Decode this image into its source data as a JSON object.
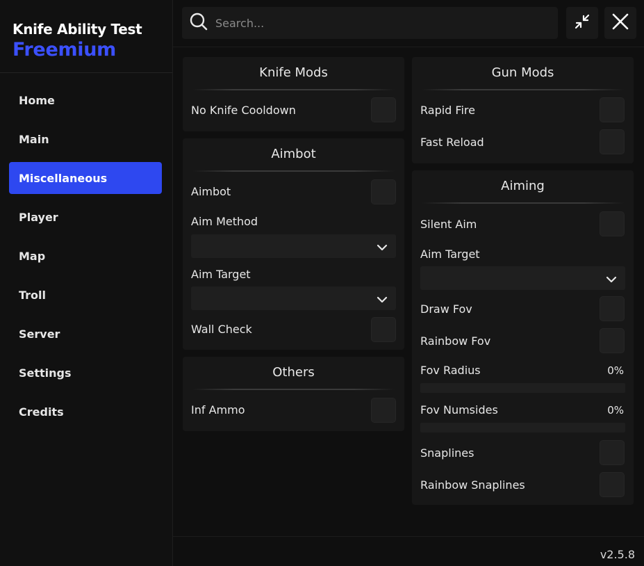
{
  "app": {
    "title": "Knife Ability Test",
    "subtitle": "Freemium",
    "version": "v2.5.8"
  },
  "search": {
    "placeholder": "Search..."
  },
  "sidebar": {
    "items": [
      {
        "label": "Home"
      },
      {
        "label": "Main"
      },
      {
        "label": "Miscellaneous",
        "active": true
      },
      {
        "label": "Player"
      },
      {
        "label": "Map"
      },
      {
        "label": "Troll"
      },
      {
        "label": "Server"
      },
      {
        "label": "Settings"
      },
      {
        "label": "Credits"
      }
    ]
  },
  "panels": {
    "knife_mods": {
      "title": "Knife Mods",
      "no_knife_cooldown": "No Knife Cooldown"
    },
    "aimbot": {
      "title": "Aimbot",
      "aimbot": "Aimbot",
      "aim_method": "Aim Method",
      "aim_target": "Aim Target",
      "wall_check": "Wall Check"
    },
    "others": {
      "title": "Others",
      "inf_ammo": "Inf Ammo"
    },
    "gun_mods": {
      "title": "Gun Mods",
      "rapid_fire": "Rapid Fire",
      "fast_reload": "Fast Reload"
    },
    "aiming": {
      "title": "Aiming",
      "silent_aim": "Silent Aim",
      "aim_target": "Aim Target",
      "draw_fov": "Draw Fov",
      "rainbow_fov": "Rainbow Fov",
      "fov_radius": "Fov Radius",
      "fov_radius_value": "0%",
      "fov_numsides": "Fov Numsides",
      "fov_numsides_value": "0%",
      "snaplines": "Snaplines",
      "rainbow_snaplines": "Rainbow Snaplines"
    }
  },
  "colors": {
    "accent": "#2e48f0",
    "brand_subtitle": "#3b50ff",
    "background": "#0f0f0f",
    "panel": "#171717"
  },
  "icons": {
    "search": "search-icon",
    "minimize": "minimize-icon",
    "close": "close-icon",
    "chevron": "chevron-down-icon"
  }
}
